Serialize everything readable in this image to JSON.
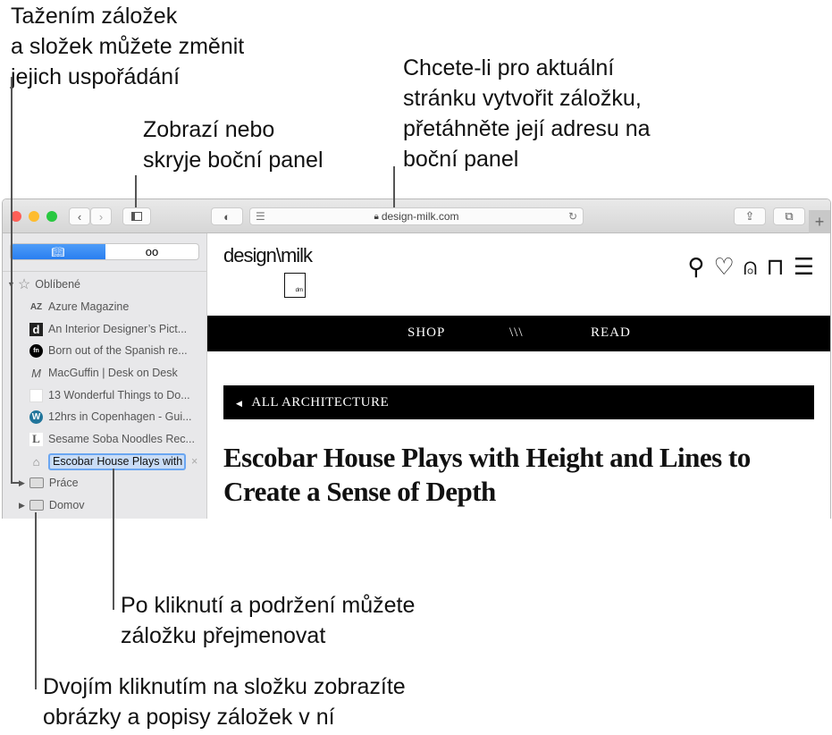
{
  "annotations": {
    "reorder": [
      "Tažením záložek",
      "a složek můžete změnit",
      "jejich uspořádání"
    ],
    "sidebar_toggle": [
      "Zobrazí nebo",
      "skryje boční panel"
    ],
    "add_bookmark": [
      "Chcete-li pro aktuální",
      "stránku vytvořit záložku,",
      "přetáhněte její adresu na",
      "boční panel"
    ],
    "rename": [
      "Po kliknutí a podržení můžete",
      "záložku přejmenovat"
    ],
    "folder": [
      "Dvojím kliknutím na složku zobrazíte",
      "obrázky a popisy záložek v ní"
    ]
  },
  "browser": {
    "url": "design-milk.com",
    "colors": {
      "close": "#fe5f57",
      "minimize": "#febc2e",
      "zoom": "#28c840",
      "accent": "#2a7ff0"
    }
  },
  "sidebar": {
    "tabs": [
      {
        "icon": "book-icon"
      },
      {
        "icon": "glasses-icon"
      }
    ],
    "favorites_label": "Oblíbené",
    "bookmarks": [
      {
        "favicon": "AZ",
        "title": "Azure Magazine"
      },
      {
        "favicon": "d",
        "title": "An Interior Designer’s Pict..."
      },
      {
        "favicon": "fn",
        "title": "Born out of the Spanish re..."
      },
      {
        "favicon": "M",
        "title": "MacGuffin | Desk on Desk"
      },
      {
        "favicon": "",
        "title": "13 Wonderful Things to Do..."
      },
      {
        "favicon": "W",
        "title": "12hrs in Copenhagen - Gui..."
      },
      {
        "favicon": "L",
        "title": "Sesame Soba Noodles Rec..."
      }
    ],
    "editing_bookmark": "Escobar House Plays with",
    "folders": [
      "Práce",
      "Domov"
    ]
  },
  "page": {
    "logo": "design\\milk",
    "logo_sub": "dm",
    "nav": [
      "SHOP",
      "\\\\\\",
      "READ"
    ],
    "breadcrumb": "ALL ARCHITECTURE",
    "title": "Escobar House Plays with Height and Lines to Create a Sense of Depth"
  }
}
